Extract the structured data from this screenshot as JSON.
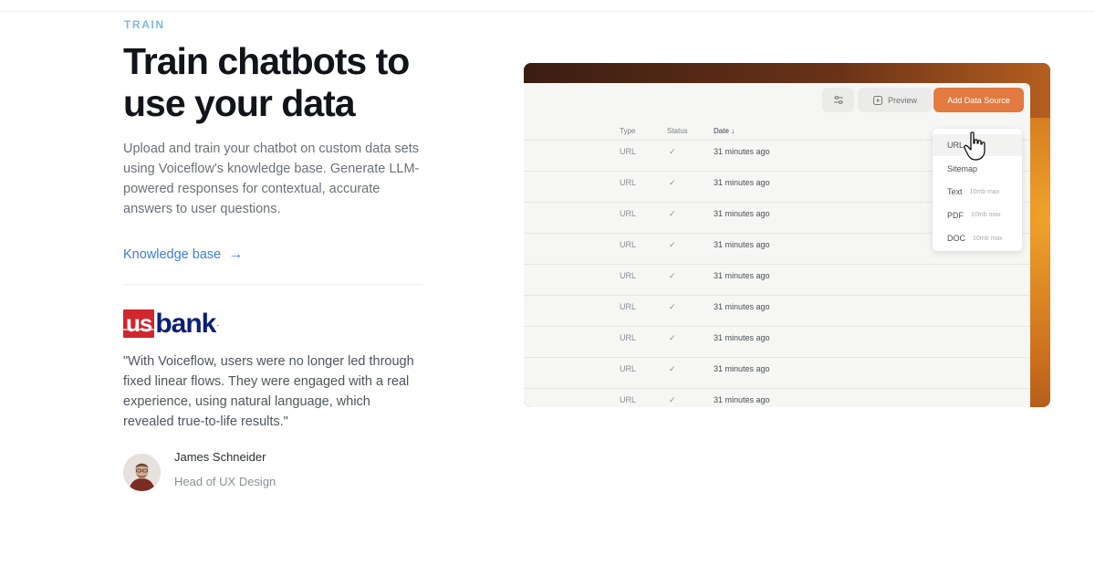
{
  "section": {
    "eyebrow": "TRAIN",
    "headline": "Train chatbots to use your data",
    "description": "Upload and train your chatbot on custom data sets using Voiceflow's knowledge base. Generate LLM-powered responses for contextual, accurate answers to user questions.",
    "link_label": "Knowledge base",
    "link_arrow": "→"
  },
  "testimonial": {
    "logo_alt": "usbank",
    "logo_us": "us",
    "logo_bank": "bank",
    "logo_dot": ".",
    "quote": "\"With Voiceflow, users were no longer led through fixed linear flows. They were engaged with a real experience, using natural language, which revealed true-to-life results.\"",
    "author_name": "James Schneider",
    "author_role": "Head of UX Design"
  },
  "product": {
    "toolbar": {
      "filter_icon": "sliders-icon",
      "preview_label": "Preview",
      "preview_icon": "play-icon",
      "add_label": "Add Data Source"
    },
    "columns": [
      "Type",
      "Status",
      "Date ↓"
    ],
    "rows": [
      {
        "type": "URL",
        "status": "✓",
        "date": "31 minutes ago"
      },
      {
        "type": "URL",
        "status": "✓",
        "date": "31 minutes ago"
      },
      {
        "type": "URL",
        "status": "✓",
        "date": "31 minutes ago"
      },
      {
        "type": "URL",
        "status": "✓",
        "date": "31 minutes ago"
      },
      {
        "type": "URL",
        "status": "✓",
        "date": "31 minutes ago"
      },
      {
        "type": "URL",
        "status": "✓",
        "date": "31 minutes ago"
      },
      {
        "type": "URL",
        "status": "✓",
        "date": "31 minutes ago"
      },
      {
        "type": "URL",
        "status": "✓",
        "date": "31 minutes ago"
      },
      {
        "type": "URL",
        "status": "✓",
        "date": "31 minutes ago"
      }
    ],
    "menu": [
      {
        "label": "URL",
        "hint": ""
      },
      {
        "label": "Sitemap",
        "hint": ""
      },
      {
        "label": "Text",
        "hint": "10mb max"
      },
      {
        "label": "PDF",
        "hint": "10mb max"
      },
      {
        "label": "DOC",
        "hint": "10mb max"
      }
    ]
  },
  "colors": {
    "accent": "#3a7dd8",
    "eyebrow": "#7fb8dd",
    "add_button": "#e37a3f",
    "usbank_red": "#d0262d",
    "usbank_navy": "#0c2074"
  }
}
